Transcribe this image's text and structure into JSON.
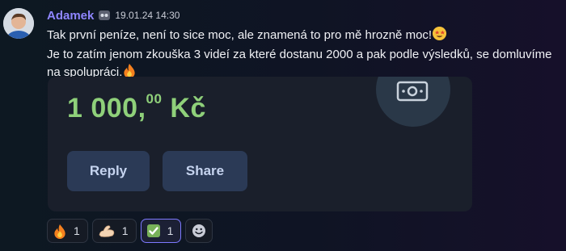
{
  "message": {
    "author": "Adamek",
    "timestamp": "19.01.24 14:30",
    "line1": "Tak první peníze, není to sice moc, ale znamená to pro mě hrozně moc!",
    "line2": "Je to zatím jenom zkouška 3 videí za které dostanu 2000 a pak podle výsledků, se domluvíme na spolupráci."
  },
  "card": {
    "amount_main": "1 000,",
    "amount_decimals": "00",
    "currency": "Kč",
    "reply_label": "Reply",
    "share_label": "Share",
    "amount_color": "#8fd07a"
  },
  "reactions": [
    {
      "emoji": "fire-emoji",
      "count": "1"
    },
    {
      "emoji": "flexed-biceps-emoji",
      "count": "1"
    },
    {
      "emoji": "check-mark-emoji",
      "count": "1"
    }
  ],
  "colors": {
    "author": "#8f86ff",
    "button_bg": "#2b3a56",
    "active_reaction_border": "#7d79ff"
  }
}
